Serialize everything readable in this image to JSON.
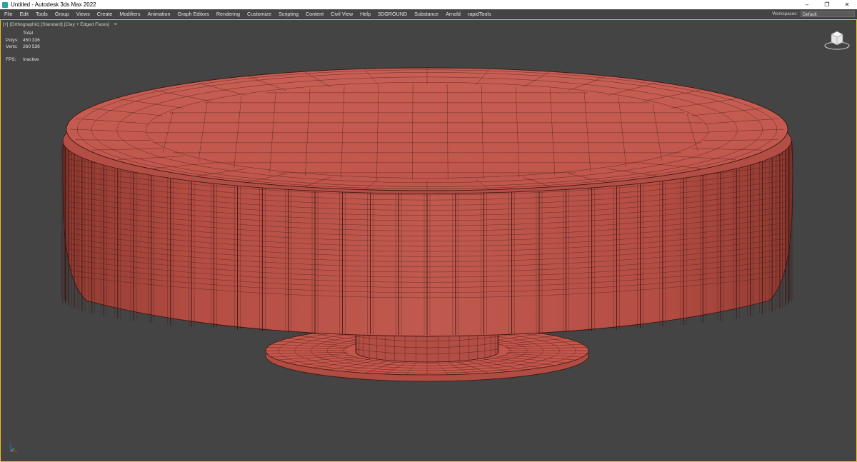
{
  "window": {
    "title": "Untitled - Autodesk 3ds Max 2022",
    "controls": [
      "–",
      "❐",
      "✕"
    ]
  },
  "menu": {
    "items": [
      "File",
      "Edit",
      "Tools",
      "Group",
      "Views",
      "Create",
      "Modifiers",
      "Animation",
      "Graph Editors",
      "Rendering",
      "Customize",
      "Scripting",
      "Content",
      "Civil View",
      "Help",
      "3DGROUND",
      "Substance",
      "Arnold",
      "rapidTools"
    ]
  },
  "workspaces": {
    "label": "Workspaces:",
    "value": "Default"
  },
  "viewport": {
    "labels": [
      "[+]",
      "[Orthographic]",
      "[Standard]",
      "[Clay + Edged Faces]"
    ],
    "filter_icon": "filter-icon",
    "stats": {
      "header": "Total",
      "polys_label": "Polys:",
      "polys_value": "450 336",
      "verts_label": "Verts:",
      "verts_value": "260 538",
      "fps_label": "FPS:",
      "fps_value": "Inactive"
    },
    "colors": {
      "clay": "#c4564b",
      "edge": "#3a1512",
      "background": "#444444",
      "active_border": "#f0c02a"
    }
  }
}
